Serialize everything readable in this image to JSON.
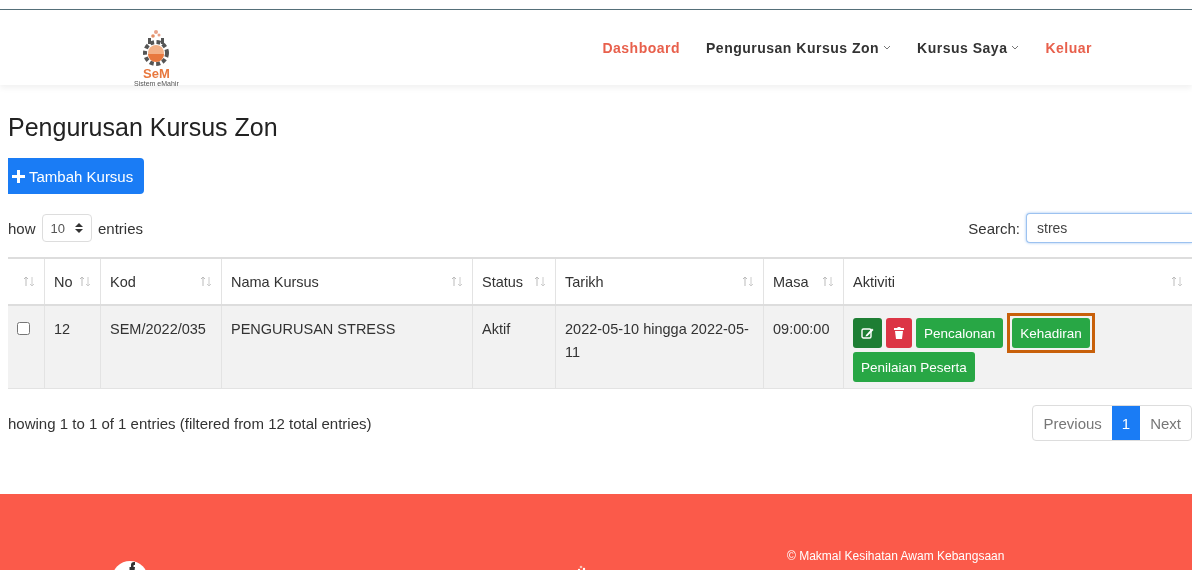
{
  "nav": {
    "logo": {
      "title": "SeM",
      "subtitle": "Sistem eMahir"
    },
    "items": [
      {
        "label": "Dashboard",
        "accent": true,
        "dropdown": false
      },
      {
        "label": "Pengurusan Kursus Zon",
        "accent": false,
        "dropdown": true
      },
      {
        "label": "Kursus Saya",
        "accent": false,
        "dropdown": true
      },
      {
        "label": "Keluar",
        "accent": true,
        "dropdown": false
      }
    ]
  },
  "page_title": "Pengurusan Kursus Zon",
  "add_button": "Tambah Kursus",
  "length": {
    "before": "how",
    "value": "10",
    "after": "entries"
  },
  "search": {
    "label": "Search:",
    "value": "stres"
  },
  "table": {
    "columns": [
      "",
      "No",
      "Kod",
      "Nama Kursus",
      "Status",
      "Tarikh",
      "Masa",
      "Aktiviti"
    ],
    "rows": [
      {
        "checked": false,
        "no": "12",
        "kod": "SEM/2022/035",
        "nama": "PENGURUSAN STRESS",
        "status": "Aktif",
        "tarikh": "2022-05-10 hingga 2022-05-11",
        "masa": "09:00:00",
        "actions": [
          {
            "kind": "edit",
            "highlighted": false
          },
          {
            "kind": "delete",
            "highlighted": false
          },
          {
            "kind": "text",
            "label": "Pencalonan",
            "highlighted": false
          },
          {
            "kind": "text",
            "label": "Kehadiran",
            "highlighted": true
          },
          {
            "kind": "text",
            "label": "Penilaian Peserta",
            "highlighted": false
          }
        ]
      }
    ]
  },
  "info": "howing 1 to 1 of 1 entries (filtered from 12 total entries)",
  "pagination": [
    {
      "label": "Previous",
      "selected": false
    },
    {
      "label": "1",
      "selected": true
    },
    {
      "label": "Next",
      "selected": false
    }
  ],
  "footer": {
    "copyright": "© Makmal Kesihatan Awam Kebangsaan"
  }
}
